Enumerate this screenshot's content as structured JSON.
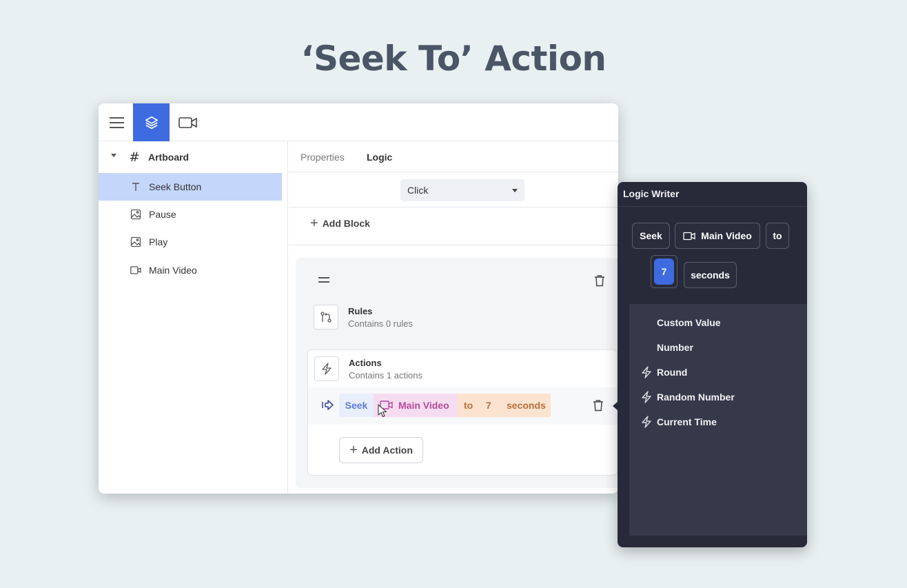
{
  "page_title": "‘Seek To’ Action",
  "topbar": {
    "menu_icon": "hamburger-menu-icon",
    "layers_icon": "layers-icon",
    "video_icon": "video-camera-icon"
  },
  "layers": {
    "root": {
      "label": "Artboard",
      "icon": "hash-icon"
    },
    "items": [
      {
        "label": "Seek Button",
        "icon": "text-icon",
        "selected": true
      },
      {
        "label": "Pause",
        "icon": "image-icon"
      },
      {
        "label": "Play",
        "icon": "image-icon"
      },
      {
        "label": "Main Video",
        "icon": "video-camera-icon"
      }
    ]
  },
  "panel": {
    "tabs": [
      "Properties",
      "Logic"
    ],
    "active_tab": "Logic",
    "event_select": "Click",
    "add_block": "Add Block"
  },
  "block": {
    "rules": {
      "title": "Rules",
      "subtitle": "Contains 0 rules"
    },
    "actions": {
      "title": "Actions",
      "subtitle": "Contains 1 actions"
    },
    "action_line": {
      "verb": "Seek",
      "target": "Main Video",
      "to": "to",
      "value": "7",
      "unit": "seconds"
    },
    "add_action": "Add Action"
  },
  "logic_writer": {
    "title": "Logic Writer",
    "tokens": {
      "seek": "Seek",
      "video": "Main Video",
      "to": "to",
      "value": "7",
      "unit": "seconds"
    },
    "menu": [
      {
        "label": "Custom Value",
        "bolt": false
      },
      {
        "label": "Number",
        "bolt": false
      },
      {
        "label": "Round",
        "bolt": true
      },
      {
        "label": "Random Number",
        "bolt": true
      },
      {
        "label": "Current Time",
        "bolt": true
      }
    ]
  },
  "colors": {
    "accent": "#3e6be0",
    "selected_layer": "#c5d6fb",
    "logic_writer_bg": "#282a3a"
  }
}
